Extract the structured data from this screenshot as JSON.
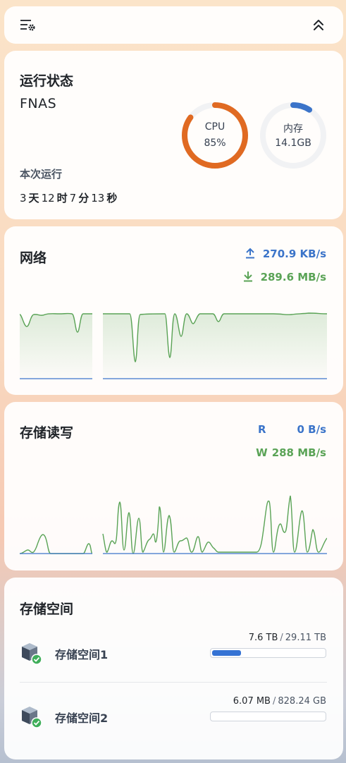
{
  "toolbar": {
    "settings_icon": "list-settings-icon",
    "collapse_icon": "double-chevron-up-icon"
  },
  "status": {
    "title": "运行状态",
    "hostname": "FNAS",
    "uptime_label": "本次运行",
    "uptime": {
      "days": "3",
      "days_unit": "天",
      "hours": "12",
      "hours_unit": "时",
      "minutes": "7",
      "minutes_unit": "分",
      "seconds": "13",
      "seconds_unit": "秒"
    },
    "cpu": {
      "label": "CPU",
      "value_text": "85%",
      "fraction": 0.85,
      "color": "#e06a22"
    },
    "memory": {
      "label": "内存",
      "value_text": "14.1GB",
      "fraction": 0.09,
      "color": "#3b74c9"
    }
  },
  "network": {
    "title": "网络",
    "upload": "270.9 KB/s",
    "download": "289.6 MB/s",
    "upload_color": "#3b74c9",
    "download_color": "#5aa356"
  },
  "storage_io": {
    "title": "存储读写",
    "read_label": "R",
    "read_value": "0 B/s",
    "write_label": "W",
    "write_value": "288 MB/s"
  },
  "storage_space": {
    "title": "存储空间",
    "volumes": [
      {
        "name": "存储空间1",
        "used": "7.6 TB",
        "separator": "/",
        "total": "29.11 TB",
        "fraction": 0.26
      },
      {
        "name": "存储空间2",
        "used": "6.07 MB",
        "separator": "/",
        "total": "828.24 GB",
        "fraction": 0.0
      }
    ]
  }
}
